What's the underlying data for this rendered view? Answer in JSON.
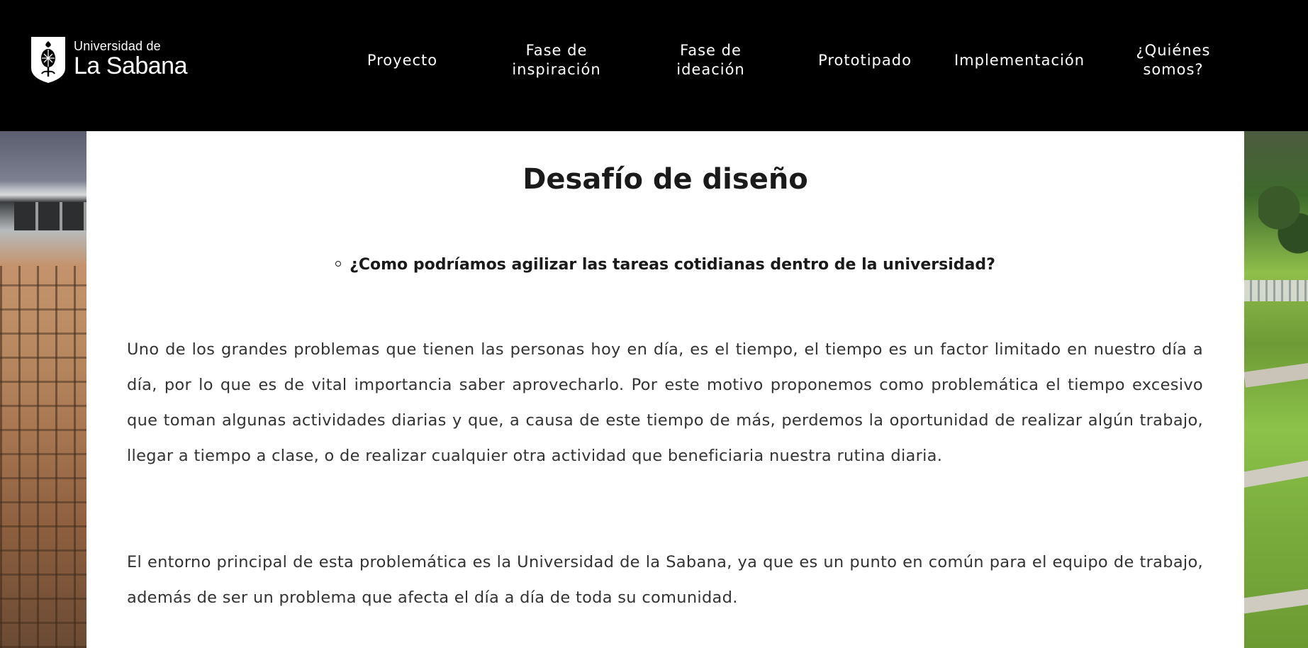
{
  "header": {
    "logo": {
      "small": "Universidad de",
      "big": "La Sabana"
    },
    "nav": [
      {
        "label": "Proyecto"
      },
      {
        "label": "Fase de\ninspiración"
      },
      {
        "label": "Fase de\nideación"
      },
      {
        "label": "Prototipado"
      },
      {
        "label": "Implementación"
      },
      {
        "label": "¿Quiénes\nsomos?"
      }
    ]
  },
  "main": {
    "title": "Desafío de diseño",
    "question": "¿Como podríamos agilizar las tareas cotidianas dentro de la universidad?",
    "paragraphs": [
      "Uno de los grandes problemas que tienen las personas hoy en día, es el tiempo, el tiempo es un factor limitado en nuestro día a día, por lo que es de vital importancia saber aprovecharlo. Por este motivo proponemos como problemática el tiempo excesivo que toman algunas actividades diarias y que, a causa de este tiempo de más, perdemos la oportunidad de realizar algún trabajo, llegar a tiempo a clase, o de realizar cualquier otra actividad que beneficiaria nuestra rutina diaria.",
      "El entorno principal de esta problemática es la Universidad de la Sabana, ya que es un punto en común para el equipo de trabajo, además de ser un problema que afecta el día a día de toda su comunidad."
    ]
  },
  "colors": {
    "header_bg": "#000000",
    "text_dark": "#1a1a1a",
    "text_body": "#333333"
  }
}
